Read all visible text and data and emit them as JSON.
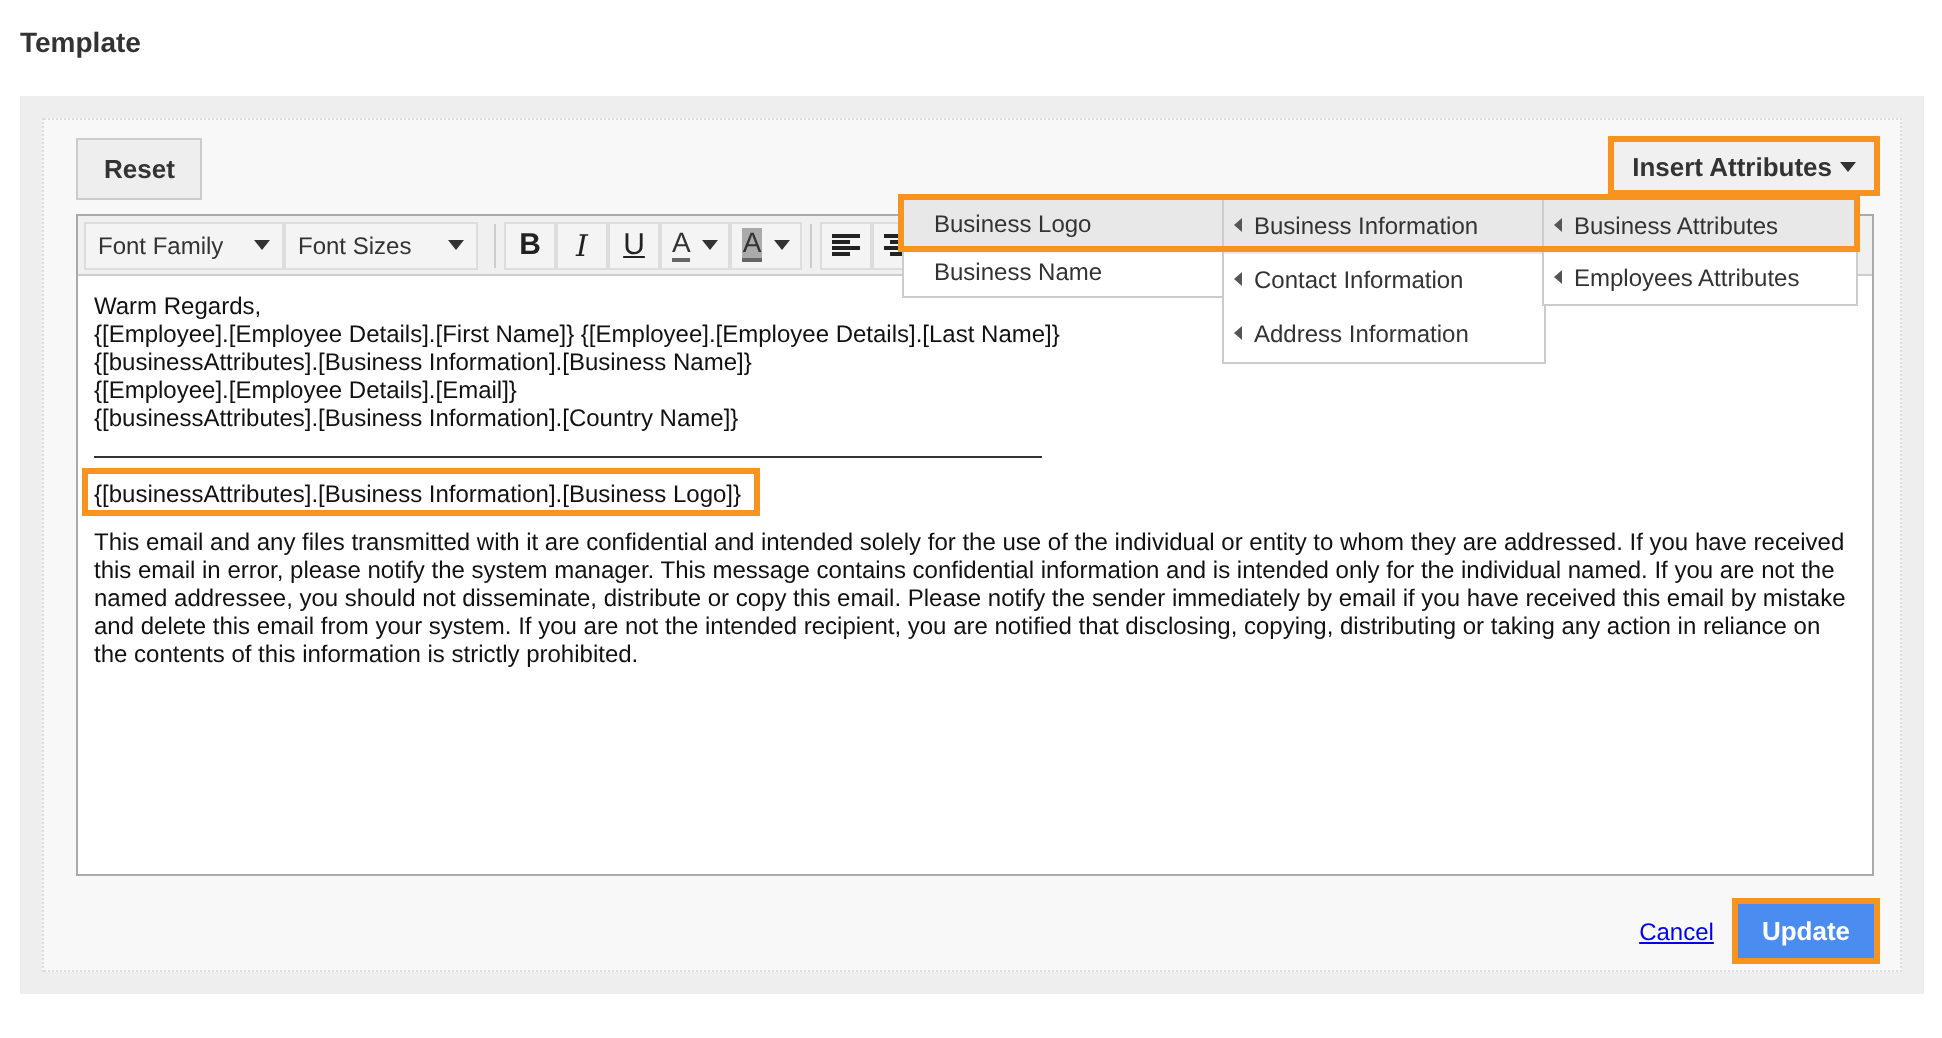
{
  "page_title": "Template",
  "reset_button": "Reset",
  "insert_button": {
    "label": "Insert Attributes",
    "highlighted": true
  },
  "toolbar": [
    {
      "kind": "select",
      "label": "Font Family"
    },
    {
      "kind": "select",
      "label": "Font Sizes"
    },
    {
      "kind": "bold",
      "label": "B"
    },
    {
      "kind": "italic",
      "label": "I"
    },
    {
      "kind": "underline",
      "label": "U"
    },
    {
      "kind": "color",
      "label": "A"
    },
    {
      "kind": "highlight",
      "label": "A"
    },
    {
      "kind": "align-left"
    },
    {
      "kind": "align-center"
    }
  ],
  "editor_lines": [
    "Warm Regards,",
    "{[Employee].[Employee Details].[First Name]}  {[Employee].[Employee Details].[Last Name]}",
    "{[businessAttributes].[Business Information].[Business Name]}",
    "{[Employee].[Employee Details].[Email]}",
    "{[businessAttributes].[Business Information].[Country Name]}"
  ],
  "logo_line": {
    "text": "{[businessAttributes].[Business Information].[Business Logo]}",
    "highlighted": true
  },
  "disclaimer": "This email and any files transmitted with it are confidential and intended solely for the use of the individual or entity to whom they are addressed. If you have received this email in error, please notify the system manager. This message contains confidential information and is intended only for the individual named. If you are not the named addressee, you should not disseminate, distribute or copy this email. Please notify the sender immediately by email if you have received this email by mistake and delete this email from your system. If you are not the intended recipient, you are notified that disclosing, copying, distributing or taking any action in reliance on the contents of this information is strictly prohibited.",
  "menu_columns": [
    {
      "submenu_arrows": false,
      "items": [
        {
          "label": "Business Logo",
          "selected": true
        },
        {
          "label": "Business Name",
          "selected": false
        }
      ]
    },
    {
      "submenu_arrows": true,
      "items": [
        {
          "label": "Business Information",
          "selected": true
        },
        {
          "label": "Contact Information",
          "selected": false
        },
        {
          "label": "Address Information",
          "selected": false
        }
      ]
    },
    {
      "submenu_arrows": true,
      "items": [
        {
          "label": "Business Attributes",
          "selected": true
        },
        {
          "label": "Employees Attributes",
          "selected": false
        }
      ]
    }
  ],
  "menu_path_highlighted": true,
  "cancel_link": "Cancel",
  "update_button": {
    "label": "Update",
    "highlighted": true
  }
}
